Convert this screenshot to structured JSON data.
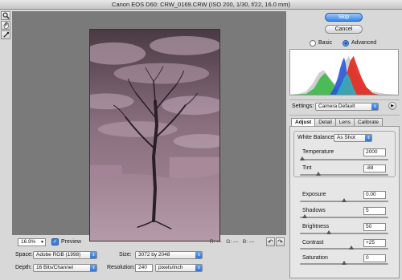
{
  "window": {
    "title": "Canon EOS D60:  CRW_0169.CRW  (ISO 200, 1/30, f/22, 16.0 mm)"
  },
  "tools": [
    {
      "name": "zoom-tool-icon"
    },
    {
      "name": "hand-tool-icon"
    },
    {
      "name": "eyedropper-tool-icon"
    }
  ],
  "status": {
    "zoom": "16.9%",
    "preview_label": "Preview",
    "preview_checked": true,
    "r_readout": "R: ---",
    "g_readout": "G: ---",
    "b_readout": "B: ---"
  },
  "workflow": {
    "space_label": "Space:",
    "space_value": "Adobe RGB (1998)",
    "size_label": "Size:",
    "size_value": "3072 by 2048",
    "depth_label": "Depth:",
    "depth_value": "16 Bits/Channel",
    "resolution_label": "Resolution:",
    "resolution_value": "240",
    "resolution_unit": "pixels/inch"
  },
  "buttons": {
    "skip": "Skip",
    "cancel": "Cancel"
  },
  "mode": {
    "basic": "Basic",
    "advanced": "Advanced",
    "selected": "advanced"
  },
  "settings": {
    "label": "Settings:",
    "value": "Camera Default"
  },
  "tabs": [
    {
      "label": "Adjust",
      "active": true
    },
    {
      "label": "Detail",
      "active": false
    },
    {
      "label": "Lens",
      "active": false
    },
    {
      "label": "Calibrate",
      "active": false
    }
  ],
  "adjust": {
    "white_balance_label": "White Balance:",
    "white_balance_value": "As Shot",
    "sliders": [
      {
        "label": "Temperature",
        "value": "2000",
        "level": 0.03
      },
      {
        "label": "Tint",
        "value": "-88",
        "level": 0.21
      },
      {
        "label": "Exposure",
        "value": "0.00",
        "level": 0.5
      },
      {
        "label": "Shadows",
        "value": "5",
        "level": 0.05
      },
      {
        "label": "Brightness",
        "value": "50",
        "level": 0.33
      },
      {
        "label": "Contrast",
        "value": "+25",
        "level": 0.58
      },
      {
        "label": "Saturation",
        "value": "0",
        "level": 0.5
      }
    ]
  },
  "colors": {
    "accent": "#3b86e6",
    "photo_tint": "#9a7a8c"
  }
}
